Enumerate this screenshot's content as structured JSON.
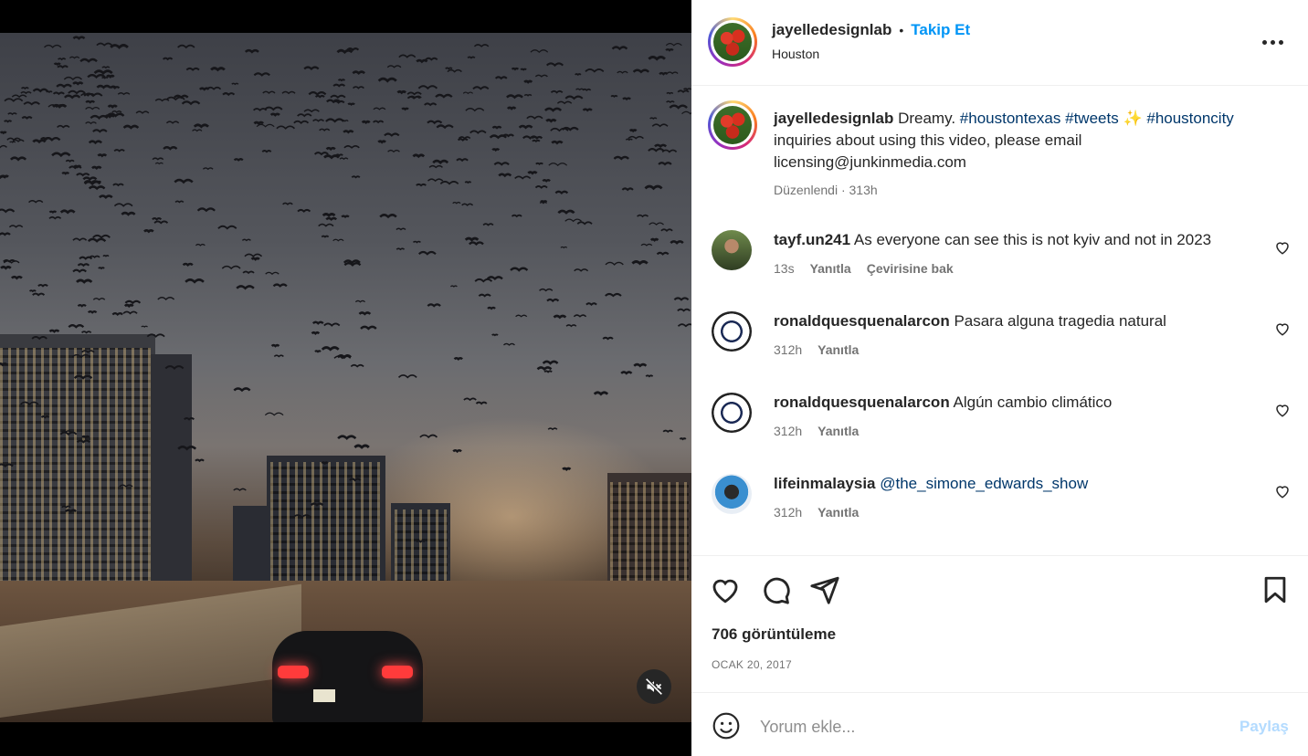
{
  "post": {
    "username": "jayelledesignlab",
    "separator": "•",
    "follow_label": "Takip Et",
    "location": "Houston",
    "more_label": "...",
    "caption_user": "jayelledesignlab",
    "caption_text_1": "Dreamy.",
    "tag_1": "#houstontexas",
    "tag_2": "#tweets",
    "emoji": "✨",
    "tag_3": "#houstoncity",
    "caption_text_2": "inquiries about using this video, please email licensing@junkinmedia.com",
    "edited": "Düzenlendi",
    "edited_sep": "·",
    "caption_time": "313h"
  },
  "comments": [
    {
      "user": "tayf.un241",
      "text": "As everyone can see this is not kyiv and not in 2023",
      "time": "13s",
      "reply": "Yanıtla",
      "translate": "Çevirisine bak"
    },
    {
      "user": "ronaldquesquenalarcon",
      "text": "Pasara alguna tragedia natural",
      "time": "312h",
      "reply": "Yanıtla"
    },
    {
      "user": "ronaldquesquenalarcon",
      "text": "Algún cambio climático",
      "time": "312h",
      "reply": "Yanıtla"
    },
    {
      "user": "lifeinmalaysia",
      "text": "@the_simone_edwards_show",
      "time": "312h",
      "reply": "Yanıtla"
    }
  ],
  "stats": {
    "views": "706 görüntüleme",
    "date": "OCAK 20, 2017"
  },
  "add_comment": {
    "placeholder": "Yorum ekle...",
    "post_label": "Paylaş"
  },
  "colors": {
    "accent": "#0095f6",
    "hashtag": "#00376b",
    "post_disabled": "#b3dbff"
  }
}
